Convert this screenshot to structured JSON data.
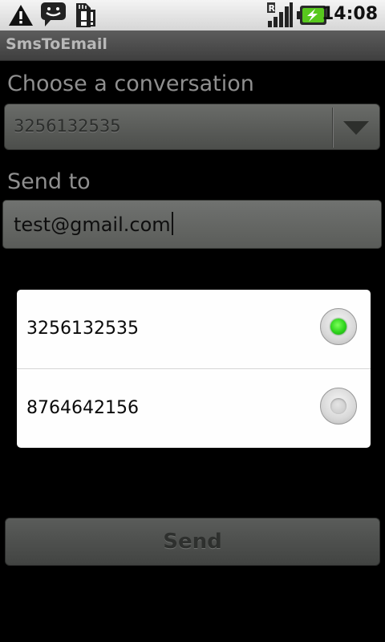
{
  "status_bar": {
    "time": "14:08",
    "icons": [
      "warning-icon",
      "sms-notification-icon",
      "sd-card-warning-icon",
      "roaming-signal-icon",
      "battery-charging-icon"
    ]
  },
  "app": {
    "title": "SmsToEmail"
  },
  "form": {
    "conversation_label": "Choose a conversation",
    "conversation_selected": "3256132535",
    "send_to_label": "Send to",
    "send_to_value": "test@gmail.com",
    "send_button": "Send"
  },
  "dialog": {
    "options": [
      {
        "number": "3256132535",
        "selected": true
      },
      {
        "number": "8764642156",
        "selected": false
      }
    ]
  },
  "colors": {
    "radio_selected": "#2ed41c",
    "background": "#000000"
  }
}
